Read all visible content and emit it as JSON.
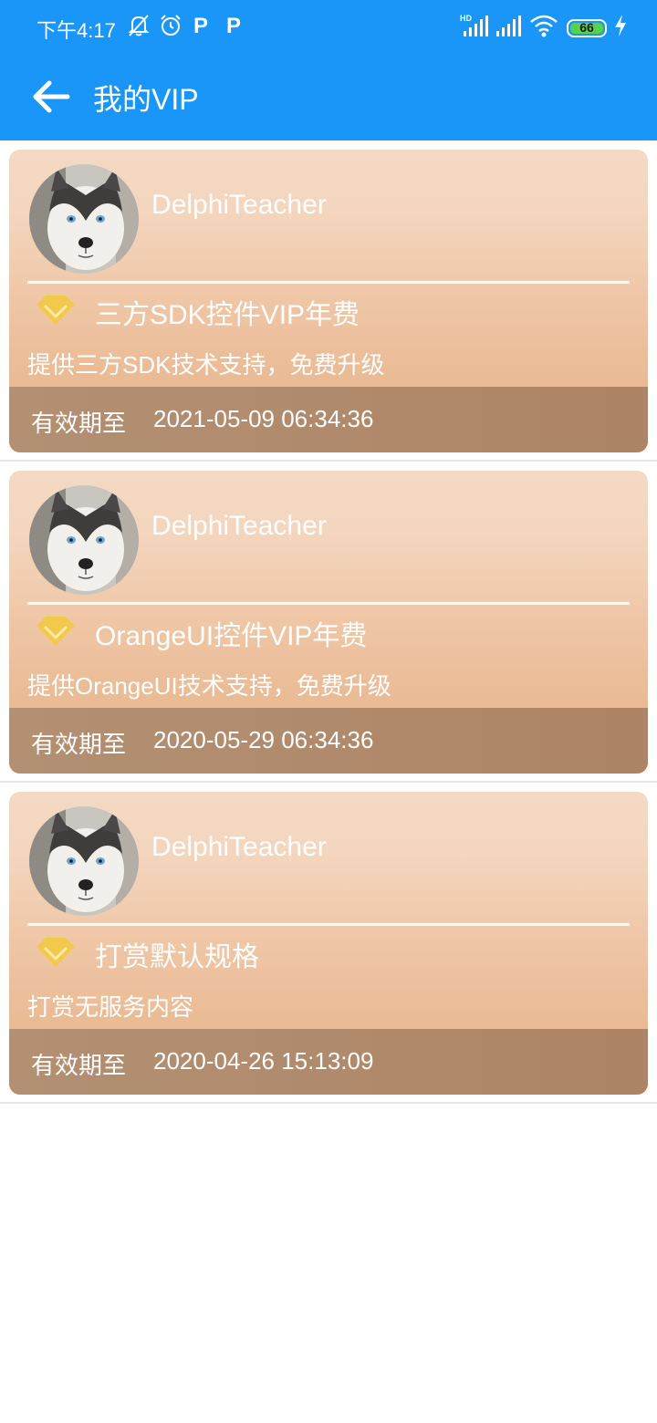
{
  "status_bar": {
    "time": "下午4:17",
    "p_mark_1": "P",
    "p_mark_2": "P",
    "battery_level": "66",
    "icons": [
      "mute-icon",
      "alarm-icon",
      "hd-signal-icon",
      "signal-icon",
      "wifi-icon",
      "battery-icon",
      "charging-icon"
    ]
  },
  "nav": {
    "back_icon": "arrow-left-icon",
    "title": "我的VIP"
  },
  "colors": {
    "header": "#1996f7",
    "card_top": "#f5d9c4",
    "card_bottom": "#e7b48b",
    "footer": "#b08a6c",
    "gem": "#f2c94c"
  },
  "cards": [
    {
      "username": "DelphiTeacher",
      "product": "三方SDK控件VIP年费",
      "description": "提供三方SDK技术支持，免费升级",
      "expiry_label": "有效期至",
      "expiry_date": "2021-05-09 06:34:36"
    },
    {
      "username": "DelphiTeacher",
      "product": "OrangeUI控件VIP年费",
      "description": "提供OrangeUI技术支持，免费升级",
      "expiry_label": "有效期至",
      "expiry_date": "2020-05-29 06:34:36"
    },
    {
      "username": "DelphiTeacher",
      "product": "打赏默认规格",
      "description": "打赏无服务内容",
      "expiry_label": "有效期至",
      "expiry_date": "2020-04-26 15:13:09"
    }
  ]
}
